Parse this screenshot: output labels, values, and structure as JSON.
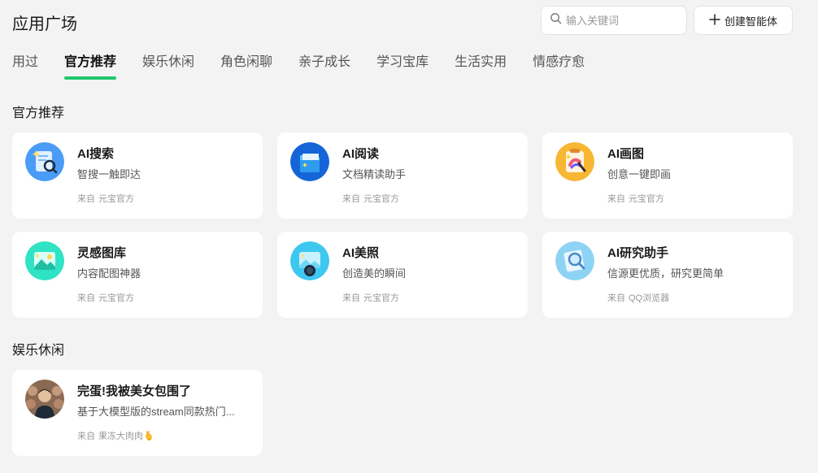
{
  "header": {
    "title": "应用广场",
    "search_placeholder": "输入关键词",
    "create_label": "创建智能体"
  },
  "tabs": [
    {
      "label": "用过",
      "active": false
    },
    {
      "label": "官方推荐",
      "active": true
    },
    {
      "label": "娱乐休闲",
      "active": false
    },
    {
      "label": "角色闲聊",
      "active": false
    },
    {
      "label": "亲子成长",
      "active": false
    },
    {
      "label": "学习宝库",
      "active": false
    },
    {
      "label": "生活实用",
      "active": false
    },
    {
      "label": "情感疗愈",
      "active": false
    }
  ],
  "sections": [
    {
      "title": "官方推荐",
      "cards": [
        {
          "name": "AI搜索",
          "desc": "智搜一触即达",
          "from": "来自",
          "source": "元宝官方",
          "icon": "ai-search-icon"
        },
        {
          "name": "AI阅读",
          "desc": "文档精读助手",
          "from": "来自",
          "source": "元宝官方",
          "icon": "ai-reading-icon"
        },
        {
          "name": "AI画图",
          "desc": "创意一键即画",
          "from": "来自",
          "source": "元宝官方",
          "icon": "ai-drawing-icon"
        },
        {
          "name": "灵感图库",
          "desc": "内容配图神器",
          "from": "来自",
          "source": "元宝官方",
          "icon": "inspiration-gallery-icon"
        },
        {
          "name": "AI美照",
          "desc": "创造美的瞬间",
          "from": "来自",
          "source": "元宝官方",
          "icon": "ai-photo-icon"
        },
        {
          "name": "AI研究助手",
          "desc": "信源更优质，研究更简单",
          "from": "来自",
          "source": "QQ浏览器",
          "icon": "ai-research-icon"
        }
      ]
    },
    {
      "title": "娱乐休闲",
      "cards": [
        {
          "name": "完蛋!我被美女包围了",
          "desc": "基于大模型版的stream同款热门...",
          "from": "来自",
          "source": "果冻大肉肉🫰",
          "icon": "avatar-photo-icon"
        }
      ]
    }
  ],
  "colors": {
    "accent": "#21c76d",
    "background": "#f3f3f3",
    "card": "#ffffff"
  }
}
